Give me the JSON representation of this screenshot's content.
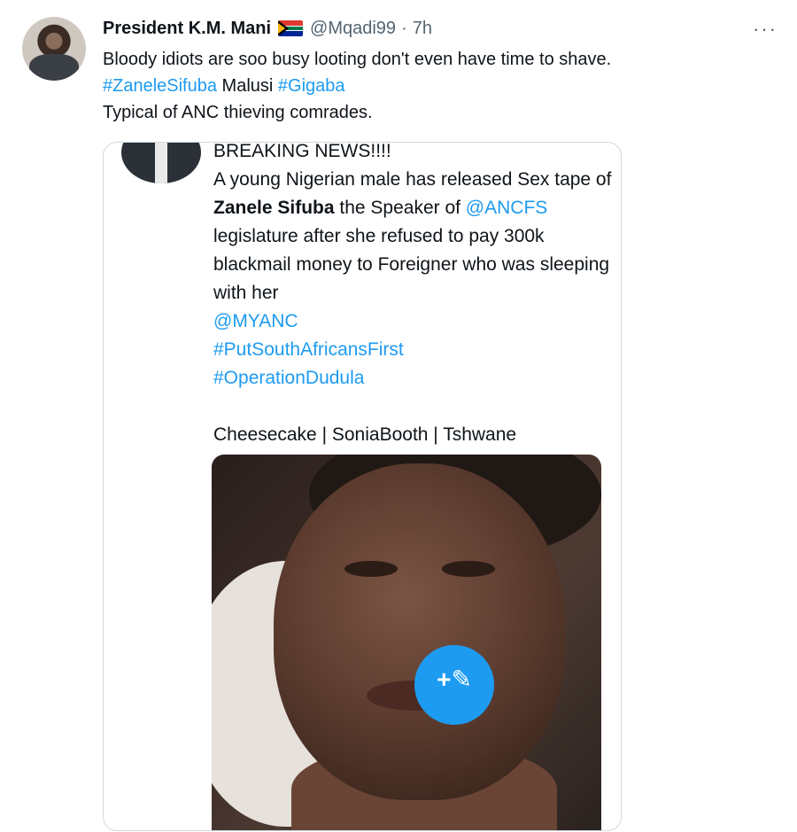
{
  "tweet": {
    "author_name": "President K.M. Mani",
    "handle": "@Mqadi99",
    "separator": "·",
    "time": "7h",
    "more_label": "···",
    "lines": {
      "line1": "Bloody idiots are soo busy looting don't even have time to shave.",
      "tag1": "#ZaneleSifuba",
      "plain1": " Malusi ",
      "tag2": "#Gigaba",
      "line3": "Typical of ANC thieving comrades."
    }
  },
  "quoted": {
    "headline": "BREAKING NEWS!!!!",
    "text_a": "A young Nigerian male has released Sex tape of ",
    "name_bold": "Zanele Sifuba",
    "text_b": " the Speaker of ",
    "mention1": "@ANCFS",
    "text_c": " legislature after she refused to pay 300k blackmail money to Foreigner who was sleeping with her",
    "mention2": "@MYANC",
    "hashtag1": "#PutSouthAfricansFirst",
    "hashtag2": "#OperationDudula",
    "footer": "Cheesecake | SoniaBooth | Tshwane"
  },
  "fab": {
    "icon": "+✎"
  },
  "colors": {
    "link": "#1d9bf0",
    "text": "#0f1419",
    "muted": "#536471",
    "border": "#cfd9de"
  },
  "icons": {
    "flag": "south-africa-flag-icon",
    "more": "more-options-icon",
    "compose": "compose-tweet-icon"
  }
}
